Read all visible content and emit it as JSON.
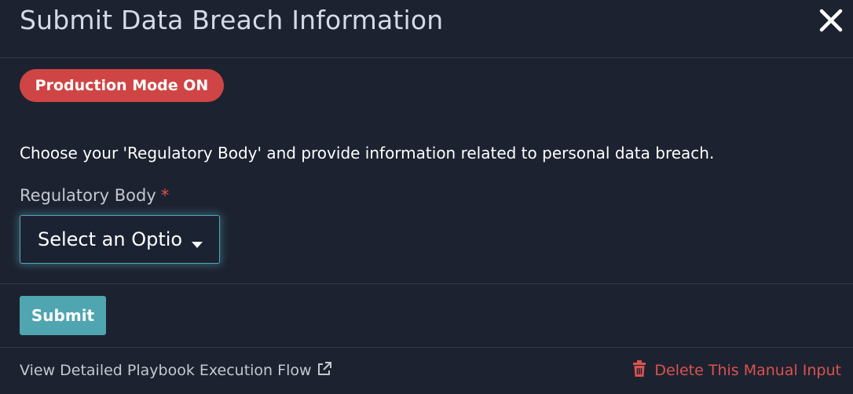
{
  "modal": {
    "title": "Submit Data Breach Information",
    "close_icon": "close-icon"
  },
  "badge": {
    "label": "Production Mode ON",
    "color": "#cf4545"
  },
  "instruction": "Choose your 'Regulatory Body' and provide information related to personal data breach.",
  "form": {
    "regulatory_body": {
      "label": "Regulatory Body",
      "required_marker": "*",
      "selected_value": "Select an Option",
      "icon": "caret-down-icon"
    }
  },
  "actions": {
    "submit_label": "Submit",
    "submit_color": "#4fa5b0"
  },
  "footer": {
    "playbook_link": "View Detailed Playbook Execution Flow",
    "playbook_icon": "external-link-icon",
    "delete_link": "Delete This Manual Input",
    "delete_icon": "trash-icon",
    "delete_color": "#d9534f"
  }
}
